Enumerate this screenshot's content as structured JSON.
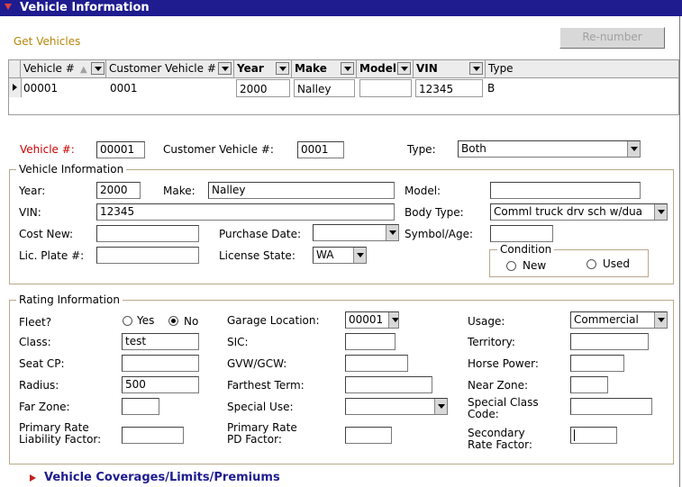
{
  "header": {
    "title": "Vehicle Information"
  },
  "toolbar": {
    "get_vehicles": "Get Vehicles",
    "renumber": "Re-number"
  },
  "grid": {
    "columns": [
      "Vehicle #",
      "Customer Vehicle #",
      "Year",
      "Make",
      "Model",
      "VIN",
      "Type"
    ],
    "row": {
      "vehicle_num": "00001",
      "customer_vehicle_num": "0001",
      "year": "2000",
      "make": "Nalley",
      "model": "",
      "vin": "12345",
      "type": "B"
    }
  },
  "top": {
    "vehicle_num_label": "Vehicle #:",
    "vehicle_num": "00001",
    "customer_vehicle_label": "Customer Vehicle #:",
    "customer_vehicle": "0001",
    "type_label": "Type:",
    "type_value": "Both"
  },
  "vehicle_info": {
    "legend": "Vehicle Information",
    "year_label": "Year:",
    "year": "2000",
    "make_label": "Make:",
    "make": "Nalley",
    "model_label": "Model:",
    "model": "",
    "vin_label": "VIN:",
    "vin": "12345",
    "body_type_label": "Body Type:",
    "body_type": "Comml truck drv sch w/dua",
    "cost_new_label": "Cost New:",
    "cost_new": "",
    "purchase_date_label": "Purchase Date:",
    "purchase_date": "",
    "symbol_age_label": "Symbol/Age:",
    "symbol_age": "",
    "lic_plate_label": "Lic. Plate #:",
    "lic_plate": "",
    "license_state_label": "License State:",
    "license_state": "WA",
    "condition_legend": "Condition",
    "condition_new": "New",
    "condition_used": "Used"
  },
  "rating": {
    "legend": "Rating Information",
    "fleet_label": "Fleet?",
    "fleet_yes": "Yes",
    "fleet_no": "No",
    "garage_label": "Garage Location:",
    "garage": "00001",
    "usage_label": "Usage:",
    "usage": "Commercial",
    "class_label": "Class:",
    "class": "test",
    "sic_label": "SIC:",
    "sic": "",
    "territory_label": "Territory:",
    "territory": "",
    "seat_cp_label": "Seat CP:",
    "seat_cp": "",
    "gvw_label": "GVW/GCW:",
    "gvw": "",
    "horse_power_label": "Horse Power:",
    "horse_power": "",
    "radius_label": "Radius:",
    "radius": "500",
    "farthest_term_label": "Farthest Term:",
    "farthest_term": "",
    "near_zone_label": "Near Zone:",
    "near_zone": "",
    "far_zone_label": "Far Zone:",
    "far_zone": "",
    "special_use_label": "Special Use:",
    "special_use": "",
    "special_class_label_1": "Special Class",
    "special_class_label_2": "Code:",
    "special_class": "",
    "prim_liab_label_1": "Primary Rate",
    "prim_liab_label_2": "Liability Factor:",
    "prim_liab": "",
    "prim_pd_label_1": "Primary Rate",
    "prim_pd_label_2": "PD Factor:",
    "prim_pd": "",
    "secondary_label_1": "Secondary",
    "secondary_label_2": "Rate Factor:",
    "secondary": ""
  },
  "footer": {
    "coverages_link": "Vehicle Coverages/Limits/Premiums"
  }
}
